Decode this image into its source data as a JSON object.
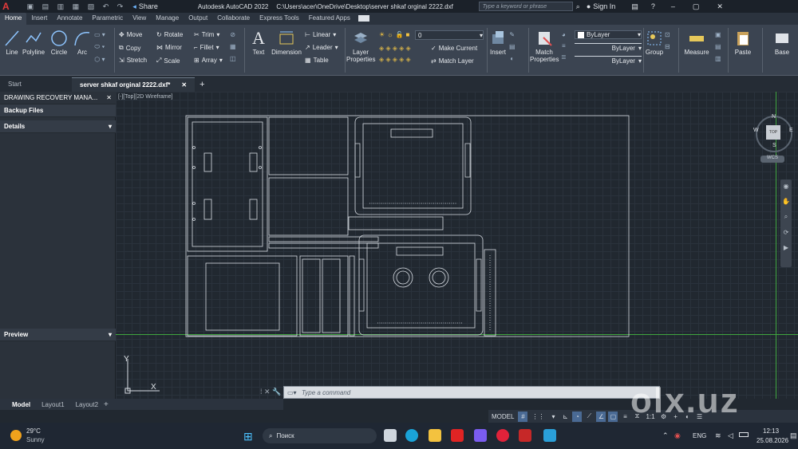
{
  "titlebar": {
    "app": "Autodesk AutoCAD 2022",
    "file_path": "C:\\Users\\acer\\OneDrive\\Desktop\\server shkaf orginal 2222.dxf",
    "share": "Share",
    "search_placeholder": "Type a keyword or phrase",
    "sign_in": "Sign In"
  },
  "ribbon_tabs": [
    "Home",
    "Insert",
    "Annotate",
    "Parametric",
    "View",
    "Manage",
    "Output",
    "Collaborate",
    "Express Tools",
    "Featured Apps"
  ],
  "ribbon": {
    "draw": [
      "Line",
      "Polyline",
      "Circle",
      "Arc"
    ],
    "modify": [
      "Move",
      "Rotate",
      "Trim",
      "Copy",
      "Mirror",
      "Fillet",
      "Stretch",
      "Scale",
      "Array"
    ],
    "annotation": [
      "Text",
      "Dimension",
      "Linear",
      "Leader",
      "Table"
    ],
    "layers": {
      "layer_properties": "Layer Properties",
      "layer_value": "0",
      "make_current": "Make Current",
      "match_layer": "Match Layer"
    },
    "block": {
      "insert": "Insert"
    },
    "properties": {
      "match_properties": "Match Properties",
      "color": "ByLayer",
      "linetype": "ByLayer",
      "lineweight": "ByLayer"
    },
    "groups": {
      "group": "Group"
    },
    "utilities": {
      "measure": "Measure"
    },
    "clipboard": {
      "paste": "Paste"
    },
    "view": {
      "base": "Base"
    }
  },
  "doc_tabs": [
    "Start",
    "server shkaf orginal 2222.dxf*"
  ],
  "palette": {
    "recovery": "DRAWING RECOVERY MANA...",
    "backup": "Backup Files",
    "details": "Details",
    "preview": "Preview"
  },
  "viewport_label": "[-][Top][2D Wireframe]",
  "viewcube": {
    "top": "TOP",
    "n": "N",
    "s": "S",
    "e": "E",
    "w": "W",
    "wcs": "WCS"
  },
  "ucs": {
    "x": "X",
    "y": "Y"
  },
  "command_placeholder": "Type a command",
  "layout_tabs": [
    "Model",
    "Layout1",
    "Layout2"
  ],
  "status": {
    "model": "MODEL",
    "scale": "1:1"
  },
  "taskbar": {
    "temperature": "29°C",
    "weather": "Sunny",
    "search": "Поиск",
    "language": "ENG",
    "time": "12:13",
    "date": "25.08.2026"
  },
  "watermark": "olx.uz"
}
